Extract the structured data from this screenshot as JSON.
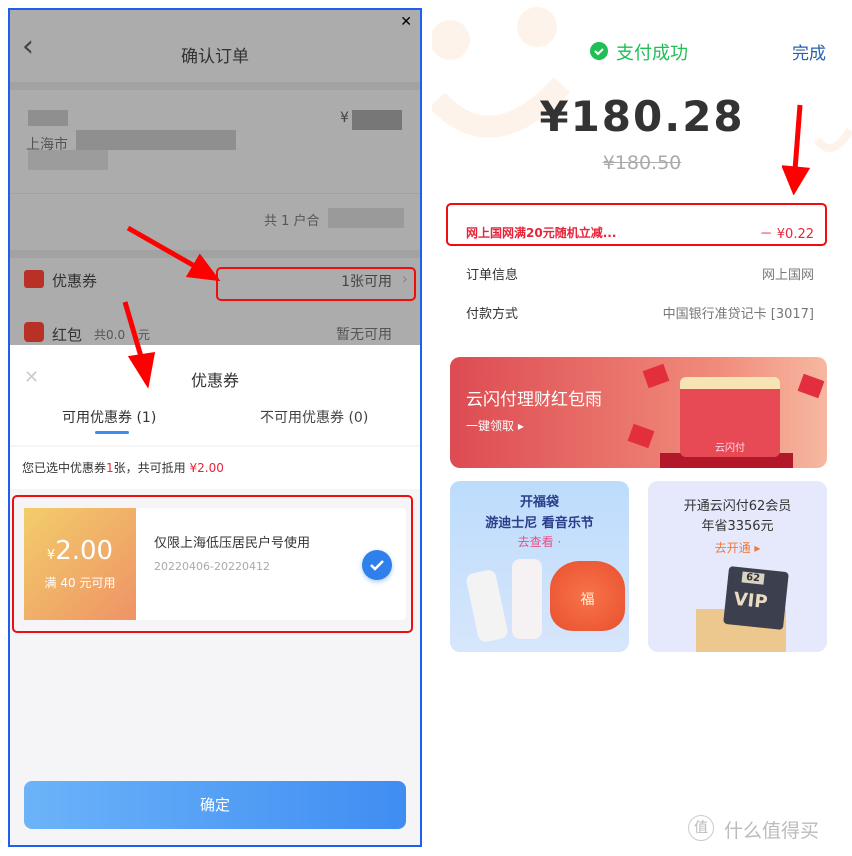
{
  "left": {
    "close_glyph": "✕",
    "header": {
      "title": "确认订单",
      "back_glyph": "‹"
    },
    "address": {
      "city": "上海市",
      "price_prefix": "¥"
    },
    "summary": {
      "label": "共 1 户合"
    },
    "coupon_row": {
      "label": "优惠券",
      "value": "1张可用",
      "chevron": "›"
    },
    "redpacket_row": {
      "label": "红包",
      "sub": "共0.0",
      "sub_suffix": "元",
      "value": "暂无可用"
    },
    "sheet": {
      "title": "优惠券",
      "close_glyph": "✕",
      "tabs": [
        {
          "label": "可用优惠券 (1)",
          "active": true
        },
        {
          "label": "不可用优惠券 (0)",
          "active": false
        }
      ],
      "notice": {
        "prefix": "您已选中优惠券",
        "count": "1",
        "mid": "张，共可抵用 ",
        "amount": "¥2.00"
      },
      "coupon": {
        "currency": "¥",
        "amount": "2.00",
        "condition": "满 40 元可用",
        "title": "仅限上海低压居民户号使用",
        "validity": "20220406-20220412",
        "selected": true
      },
      "confirm_label": "确定"
    }
  },
  "right": {
    "status": "支付成功",
    "done_label": "完成",
    "amount": "¥180.28",
    "original_amount": "¥180.50",
    "discount": {
      "label": "网上国网满20元随机立减...",
      "value": "－ ¥0.22"
    },
    "rows": [
      {
        "label": "订单信息",
        "value": "网上国网"
      },
      {
        "label": "付款方式",
        "value": "中国银行准贷记卡 [3017]"
      }
    ],
    "banner": {
      "title": "云闪付理财红包雨",
      "cta": "一键领取 ▸",
      "logo_text": "云闪付"
    },
    "card_left": {
      "line1": "开福袋",
      "line2": "游迪士尼 看音乐节",
      "cta": "去查看 ·",
      "bag_text": "福"
    },
    "card_right": {
      "line1": "开通云闪付62会员",
      "line2": "年省3356元",
      "cta": "去开通 ▸",
      "badge_top": "62",
      "badge_bottom": "VIP"
    },
    "watermark": "什么值得买",
    "watermark_logo": "值"
  },
  "colors": {
    "accent_blue": "#3b8df5",
    "success_green": "#1fbf55",
    "discount_red": "#e8243a",
    "frame_blue": "#1f5ff0"
  }
}
